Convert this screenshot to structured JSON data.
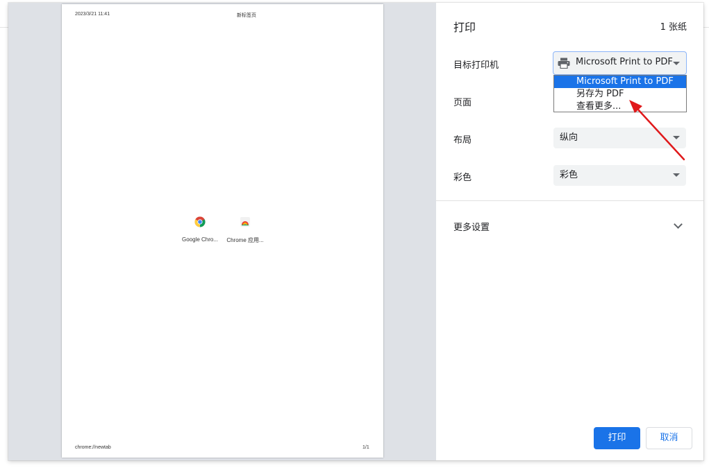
{
  "preview": {
    "header_date": "2023/3/21 11:41",
    "header_title": "新标签页",
    "footer_url": "chrome://newtab",
    "footer_page": "1/1",
    "shortcuts": [
      {
        "label": "Google Chro..."
      },
      {
        "label": "Chrome 应用..."
      }
    ]
  },
  "settings": {
    "title": "打印",
    "sheets": "1 张纸",
    "destination_label": "目标打印机",
    "destination_value": "Microsoft Print to PDF",
    "destination_options": [
      "Microsoft Print to PDF",
      "另存为 PDF",
      "查看更多..."
    ],
    "pages_label": "页面",
    "layout_label": "布局",
    "layout_value": "纵向",
    "color_label": "彩色",
    "color_value": "彩色",
    "more_settings": "更多设置",
    "print_button": "打印",
    "cancel_button": "取消"
  },
  "colors": {
    "accent": "#1a73e8",
    "annotation_arrow": "#e0191b"
  },
  "icons": {
    "printer": "printer-icon",
    "chrome": "chrome-icon",
    "chrome_apps": "chrome-apps-icon",
    "chevron": "chevron-down-icon",
    "select_arrow": "dropdown-arrow-icon"
  }
}
